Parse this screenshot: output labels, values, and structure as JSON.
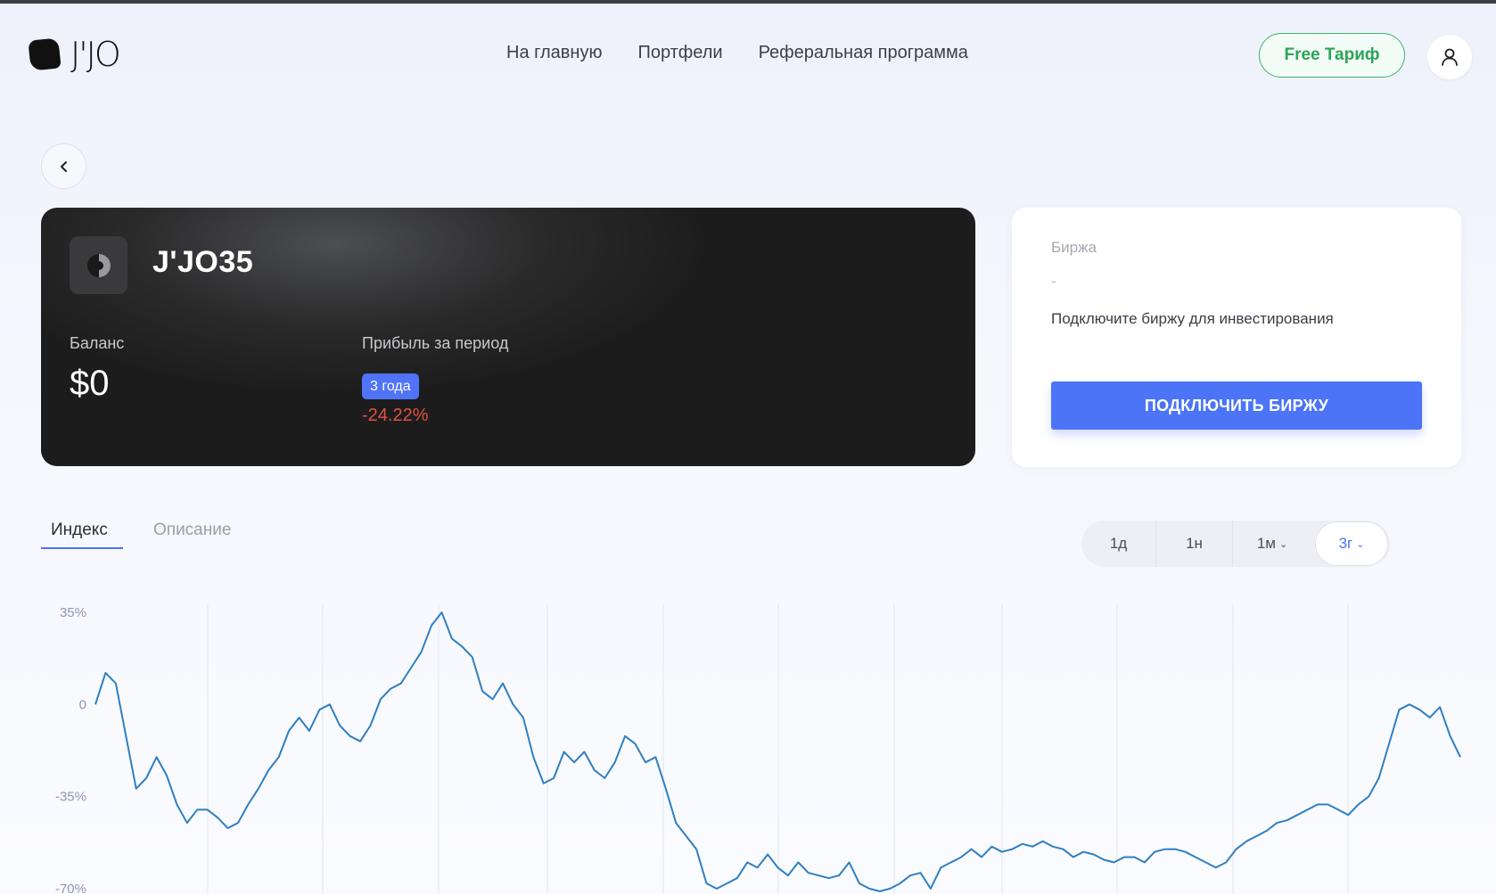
{
  "brand": {
    "name": "J'JO"
  },
  "nav": {
    "items": [
      "На главную",
      "Портфели",
      "Реферальная программа"
    ]
  },
  "header": {
    "plan_label": "Free Тариф"
  },
  "card": {
    "title": "J'JO35",
    "balance_label": "Баланс",
    "balance_value": "$0",
    "profit_label": "Прибыль за период",
    "period_badge": "3 года",
    "profit_value": "-24.22%"
  },
  "exchange": {
    "label": "Биржа",
    "value": "-",
    "hint": "Подключите биржу для инвестирования",
    "button": "ПОДКЛЮЧИТЬ БИРЖУ"
  },
  "tabs": [
    "Индекс",
    "Описание"
  ],
  "periods": [
    "1д",
    "1н",
    "1м",
    "3г"
  ],
  "active_period": "3г",
  "colors": {
    "accent": "#4b74f6",
    "negative": "#e2523f",
    "plan_green": "#2ea35a",
    "line": "#2f7fc1"
  },
  "chart_data": {
    "type": "line",
    "ylabel": "",
    "xlabel": "",
    "y_ticks": [
      "35%",
      "0",
      "-35%",
      "-70%"
    ],
    "ylim": [
      -70,
      35
    ],
    "grid": "vertical",
    "series": [
      {
        "values": [
          0,
          12,
          8,
          -12,
          -32,
          -28,
          -20,
          -27,
          -38,
          -45,
          -40,
          -40,
          -43,
          -47,
          -45,
          -38,
          -32,
          -25,
          -20,
          -10,
          -5,
          -10,
          -2,
          0,
          -8,
          -12,
          -14,
          -8,
          2,
          6,
          8,
          14,
          20,
          30,
          35,
          25,
          22,
          18,
          5,
          2,
          8,
          0,
          -5,
          -20,
          -30,
          -28,
          -18,
          -22,
          -18,
          -25,
          -28,
          -22,
          -12,
          -15,
          -22,
          -20,
          -32,
          -45,
          -50,
          -55,
          -68,
          -70,
          -68,
          -66,
          -60,
          -62,
          -57,
          -62,
          -65,
          -60,
          -64,
          -65,
          -66,
          -65,
          -60,
          -68,
          -70,
          -71,
          -70,
          -68,
          -65,
          -64,
          -70,
          -62,
          -60,
          -58,
          -55,
          -58,
          -54,
          -56,
          -55,
          -53,
          -54,
          -52,
          -54,
          -55,
          -58,
          -56,
          -57,
          -59,
          -60,
          -58,
          -58,
          -60,
          -56,
          -55,
          -55,
          -56,
          -58,
          -60,
          -62,
          -60,
          -55,
          -52,
          -50,
          -48,
          -45,
          -44,
          -42,
          -40,
          -38,
          -38,
          -40,
          -42,
          -38,
          -35,
          -28,
          -15,
          -2,
          0,
          -2,
          -5,
          -1,
          -12,
          -20
        ]
      }
    ]
  }
}
